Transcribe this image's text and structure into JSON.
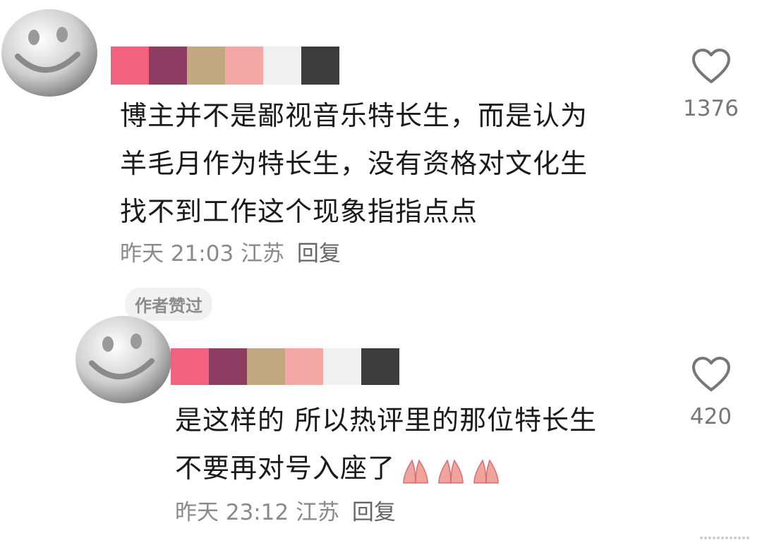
{
  "comments": [
    {
      "text_lines": [
        "博主并不是鄙视音乐特长生，而是认为",
        "羊毛月作为特长生，没有资格对文化生",
        "找不到工作这个现象指指点点"
      ],
      "time": "昨天 21:03",
      "location": "江苏",
      "reply_label": "回复",
      "likes": "1376",
      "badge": "作者赞过"
    },
    {
      "text_lines": [
        "是这样的 所以热评里的那位特长生",
        "不要再对号入座了"
      ],
      "time": "昨天 23:12",
      "location": "江苏",
      "reply_label": "回复",
      "likes": "420",
      "emoji_name": "praying-hands"
    }
  ],
  "palette_colors": [
    "#f0627e",
    "#8e3d62",
    "#c1a880",
    "#f3a8a6",
    "#f0f0f0",
    "#3c3c3c"
  ],
  "icons": {
    "avatar": "smiley-face-icon",
    "like": "heart-outline-icon"
  }
}
